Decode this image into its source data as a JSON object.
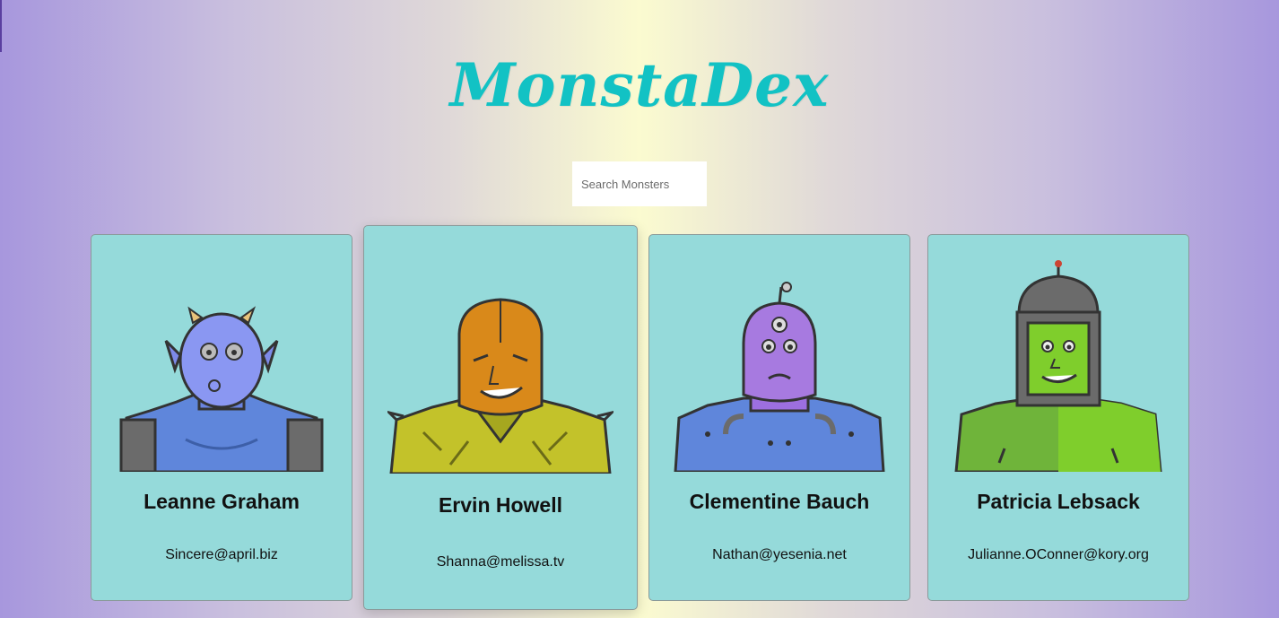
{
  "app": {
    "title": "MonstaDex"
  },
  "search": {
    "placeholder": "Search Monsters",
    "value": ""
  },
  "monsters": [
    {
      "name": "Leanne Graham",
      "email": "Sincere@april.biz",
      "icon": "monster-blue-horned-avatar",
      "color": "#7f90f0"
    },
    {
      "name": "Ervin Howell",
      "email": "Shanna@melissa.tv",
      "icon": "monster-orange-helmet-avatar",
      "color": "#d9891a"
    },
    {
      "name": "Clementine Bauch",
      "email": "Nathan@yesenia.net",
      "icon": "monster-purple-cyclops-avatar",
      "color": "#a77ae0"
    },
    {
      "name": "Patricia Lebsack",
      "email": "Julianne.OConner@kory.org",
      "icon": "monster-green-robot-avatar",
      "color": "#7fce2c"
    }
  ],
  "colors": {
    "title": "#12c2c4",
    "card": "#95dada"
  }
}
